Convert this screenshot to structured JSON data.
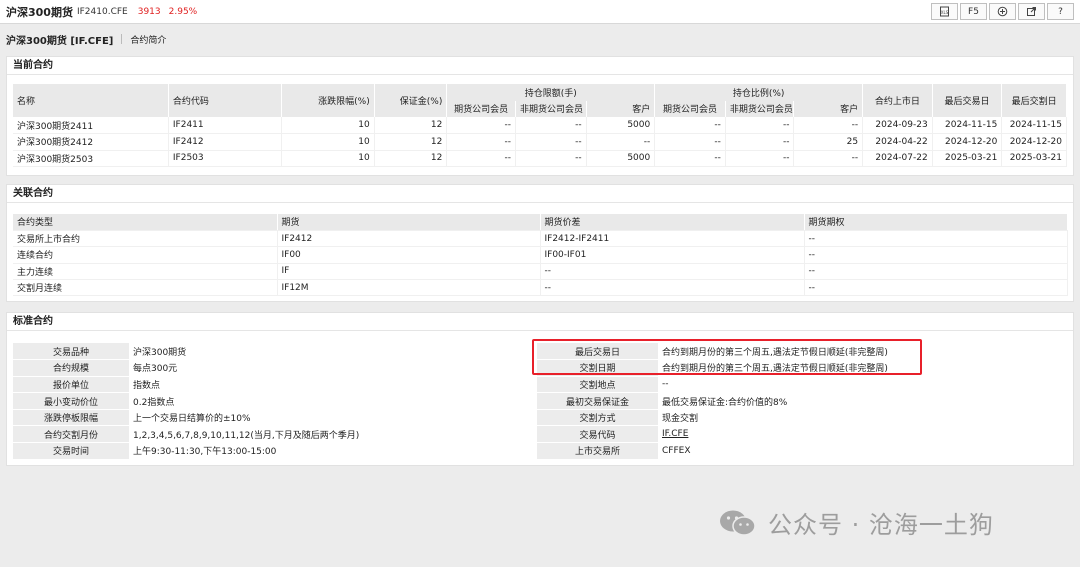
{
  "titlebar": {
    "name": "沪深300期货",
    "code": "IF2410.CFE",
    "price": "3913",
    "change_pct": "2.95%",
    "buttons": [
      "F5",
      "?"
    ]
  },
  "subbar": {
    "title": "沪深300期货 [IF.CFE]",
    "link": "合约简介"
  },
  "current": {
    "title": "当前合约",
    "headers": {
      "name": "名称",
      "code": "合约代码",
      "limit": "涨跌限幅(%)",
      "margin": "保证金(%)",
      "pos_limit": "持仓限额(手)",
      "pos_ratio": "持仓比例(%)",
      "fut_member": "期货公司会员",
      "non_fut_member": "非期货公司会员",
      "client": "客户",
      "list_date": "合约上市日",
      "last_trade": "最后交易日",
      "last_delivery": "最后交割日"
    },
    "rows": [
      {
        "name": "沪深300期货2411",
        "code": "IF2411",
        "limit": "10",
        "margin": "12",
        "a1": "--",
        "a2": "--",
        "a3": "5000",
        "b1": "--",
        "b2": "--",
        "b3": "--",
        "d1": "2024-09-23",
        "d2": "2024-11-15",
        "d3": "2024-11-15"
      },
      {
        "name": "沪深300期货2412",
        "code": "IF2412",
        "limit": "10",
        "margin": "12",
        "a1": "--",
        "a2": "--",
        "a3": "--",
        "b1": "--",
        "b2": "--",
        "b3": "25",
        "d1": "2024-04-22",
        "d2": "2024-12-20",
        "d3": "2024-12-20"
      },
      {
        "name": "沪深300期货2503",
        "code": "IF2503",
        "limit": "10",
        "margin": "12",
        "a1": "--",
        "a2": "--",
        "a3": "5000",
        "b1": "--",
        "b2": "--",
        "b3": "--",
        "d1": "2024-07-22",
        "d2": "2025-03-21",
        "d3": "2025-03-21"
      }
    ]
  },
  "related": {
    "title": "关联合约",
    "headers": [
      "合约类型",
      "期货",
      "期货价差",
      "期货期权"
    ],
    "rows": [
      [
        "交易所上市合约",
        "IF2412",
        "IF2412-IF2411",
        "--"
      ],
      [
        "连续合约",
        "IF00",
        "IF00-IF01",
        "--"
      ],
      [
        "主力连续",
        "IF",
        "--",
        "--"
      ],
      [
        "交割月连续",
        "IF12M",
        "--",
        "--"
      ]
    ]
  },
  "standard": {
    "title": "标准合约",
    "rows": [
      [
        "交易品种",
        "沪深300期货",
        "最后交易日",
        "合约到期月份的第三个周五,遇法定节假日顺延(非完整周)"
      ],
      [
        "合约规模",
        "每点300元",
        "交割日期",
        "合约到期月份的第三个周五,遇法定节假日顺延(非完整周)"
      ],
      [
        "报价单位",
        "指数点",
        "交割地点",
        "--"
      ],
      [
        "最小变动价位",
        "0.2指数点",
        "最初交易保证金",
        "最低交易保证金:合约价值的8%"
      ],
      [
        "涨跌停板限幅",
        "上一个交易日结算价的±10%",
        "交割方式",
        "现金交割"
      ],
      [
        "合约交割月份",
        "1,2,3,4,5,6,7,8,9,10,11,12(当月,下月及随后两个季月)",
        "交易代码",
        "IF.CFE"
      ],
      [
        "交易时间",
        "上午9:30-11:30,下午13:00-15:00",
        "上市交易所",
        "CFFEX"
      ]
    ]
  },
  "watermark": {
    "text": "公众号 · 沧海一土狗"
  },
  "colors": {
    "up": "#e02020",
    "highlight_border": "#e8202a",
    "header_bg": "#e9e9e9"
  }
}
